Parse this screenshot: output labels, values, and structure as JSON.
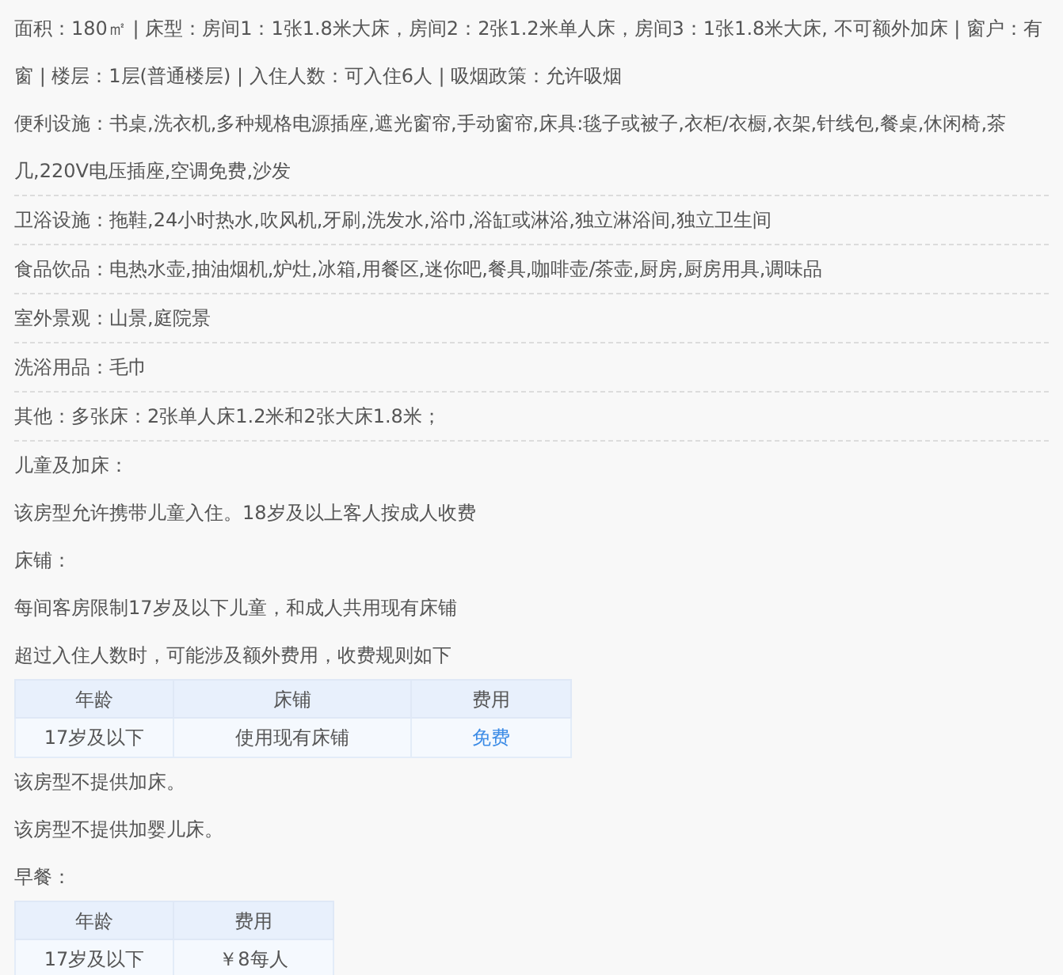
{
  "details": [
    {
      "text": "面积：180㎡ | 床型：房间1：1张1.8米大床，房间2：2张1.2米单人床，房间3：1张1.8米大床, 不可额外加床 | 窗户：有窗 | 楼层：1层(普通楼层) | 入住人数：可入住6人 | 吸烟政策：允许吸烟"
    },
    {
      "text": "便利设施：书桌,洗衣机,多种规格电源插座,遮光窗帘,手动窗帘,床具:毯子或被子,衣柜/衣橱,衣架,针线包,餐桌,休闲椅,茶几,220V电压插座,空调免费,沙发"
    },
    {
      "text": "卫浴设施：拖鞋,24小时热水,吹风机,牙刷,洗发水,浴巾,浴缸或淋浴,独立淋浴间,独立卫生间"
    },
    {
      "text": "食品饮品：电热水壶,抽油烟机,炉灶,冰箱,用餐区,迷你吧,餐具,咖啡壶/茶壶,厨房,厨房用具,调味品"
    },
    {
      "text": "室外景观：山景,庭院景"
    },
    {
      "text": "洗浴用品：毛巾"
    },
    {
      "text": "其他：多张床：2张单人床1.2米和2张大床1.8米；"
    }
  ],
  "policy": [
    {
      "kind": "paragraph",
      "text": "儿童及加床："
    },
    {
      "kind": "paragraph",
      "text": "该房型允许携带儿童入住。18岁及以上客人按成人收费"
    },
    {
      "kind": "paragraph",
      "text": "床铺："
    },
    {
      "kind": "paragraph",
      "text": "每间客房限制17岁及以下儿童，和成人共用现有床铺"
    },
    {
      "kind": "paragraph",
      "text": "超过入住人数时，可能涉及额外费用，收费规则如下"
    },
    {
      "kind": "table",
      "columns": [
        "年龄",
        "床铺",
        "费用"
      ],
      "rows": [
        [
          {
            "text": "17岁及以下",
            "emphasized": false
          },
          {
            "text": "使用现有床铺",
            "emphasized": false
          },
          {
            "text": "免费",
            "emphasized": true
          }
        ]
      ]
    },
    {
      "kind": "paragraph",
      "text": "该房型不提供加床。"
    },
    {
      "kind": "paragraph",
      "text": "该房型不提供加婴儿床。"
    },
    {
      "kind": "paragraph",
      "text": "早餐："
    },
    {
      "kind": "table",
      "columns": [
        "年龄",
        "费用"
      ],
      "rows": [
        [
          {
            "text": "17岁及以下",
            "emphasized": false
          },
          {
            "text": "￥8每人",
            "emphasized": false
          }
        ]
      ]
    }
  ]
}
